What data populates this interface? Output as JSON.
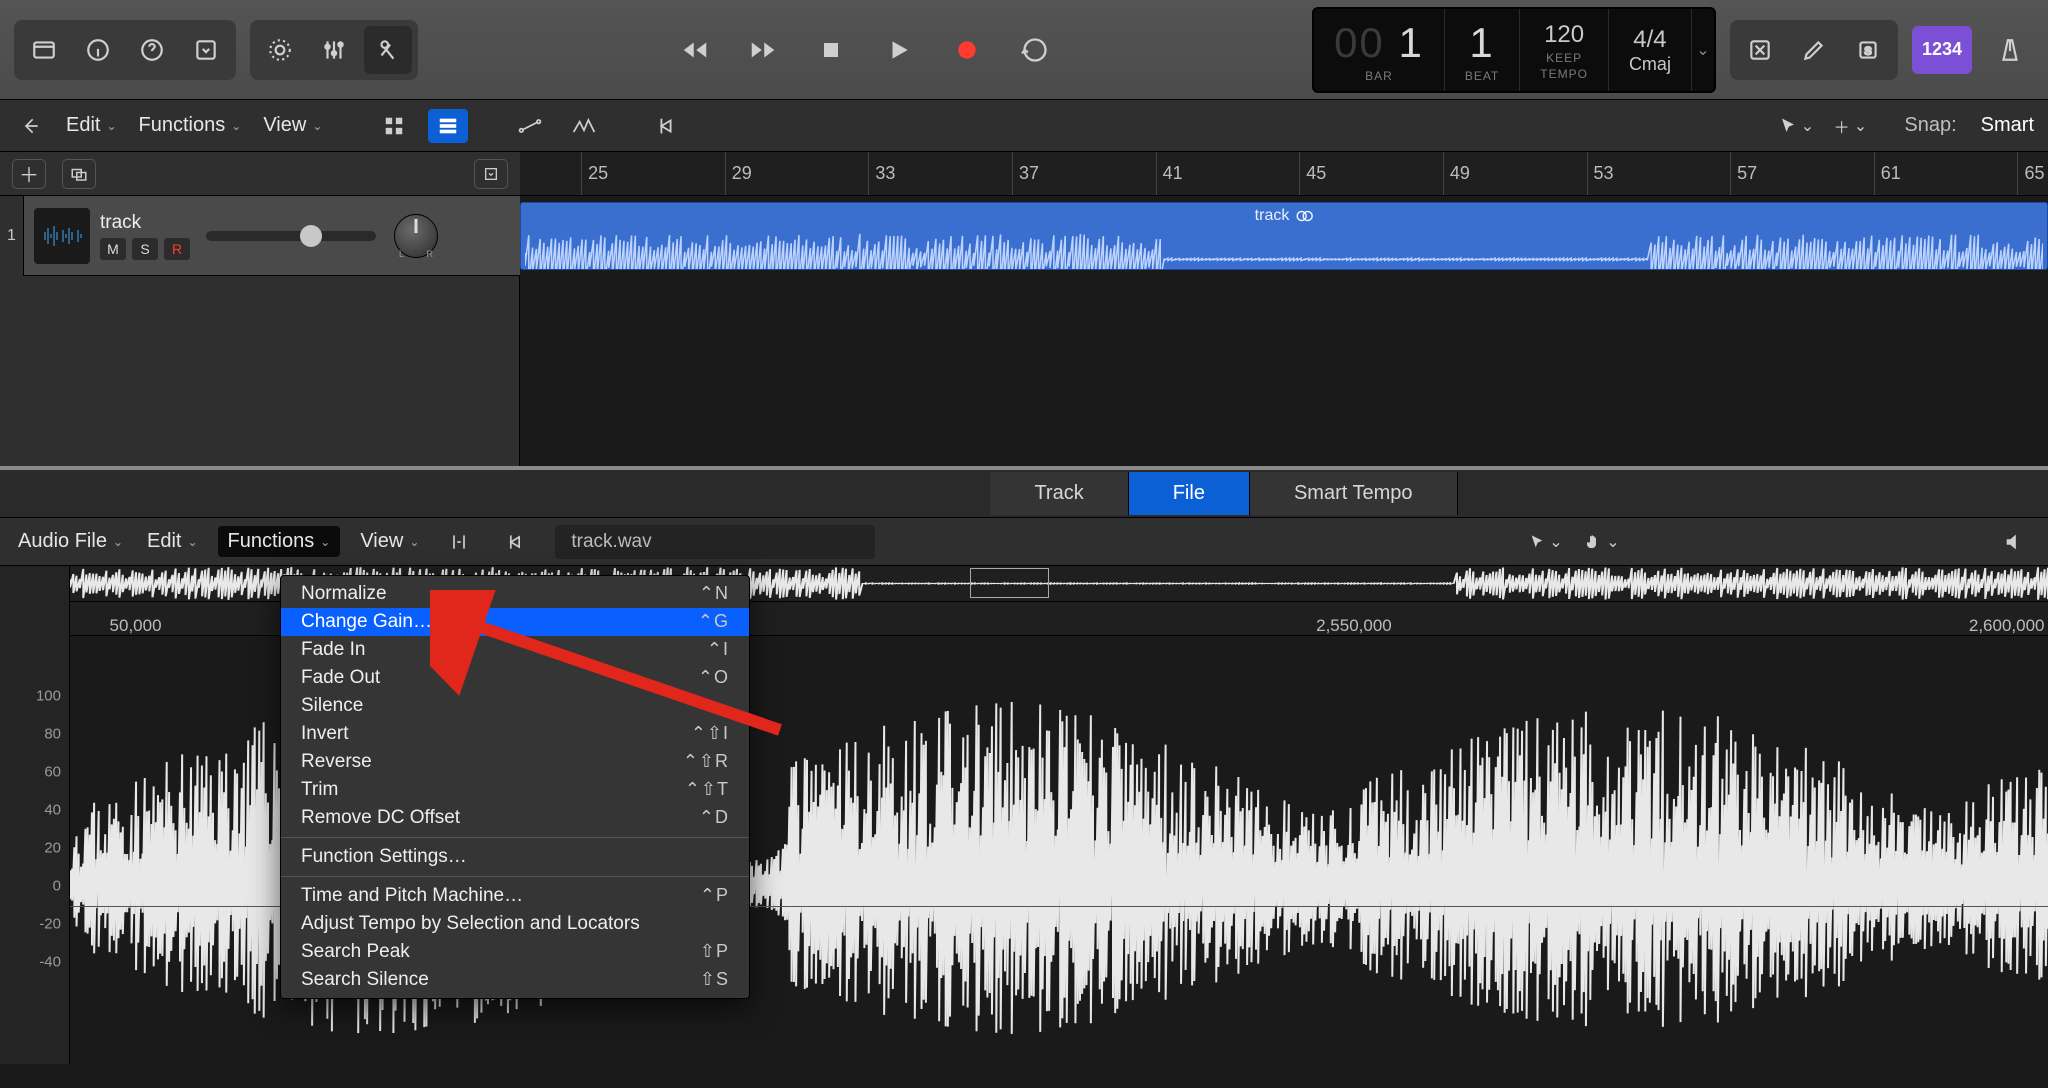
{
  "lcd": {
    "bar_dim": "00",
    "bar": "1",
    "beat": "1",
    "tempo": "120",
    "tempo_sub": "KEEP",
    "sig": "4/4",
    "key": "Cmaj",
    "lbl_bar": "BAR",
    "lbl_beat": "BEAT",
    "lbl_tempo": "TEMPO"
  },
  "badge": "1234",
  "arr": {
    "menus": [
      "Edit",
      "Functions",
      "View"
    ],
    "snap_lbl": "Snap:",
    "snap_val": "Smart",
    "ruler": [
      "25",
      "29",
      "33",
      "37",
      "41",
      "45",
      "49",
      "53",
      "57",
      "61",
      "65"
    ]
  },
  "track": {
    "index": "1",
    "name": "track",
    "m": "M",
    "s": "S",
    "r": "R",
    "pan_l": "L",
    "pan_r": "R",
    "region": "track"
  },
  "ed_tabs": [
    "Track",
    "File",
    "Smart Tempo"
  ],
  "ed_tabs_active": 1,
  "ed_bar": {
    "menus": [
      "Audio File",
      "Edit",
      "Functions",
      "View"
    ],
    "filename": "track.wav"
  },
  "sample_ruler": [
    "50,000",
    "2,550,000",
    "2,600,000"
  ],
  "gutter": [
    "100",
    "80",
    "60",
    "40",
    "20",
    "0",
    "-20",
    "-40"
  ],
  "ctx": {
    "g1": [
      {
        "l": "Normalize",
        "s": "⌃N"
      },
      {
        "l": "Change Gain…",
        "s": "⌃G",
        "hl": true
      },
      {
        "l": "Fade In",
        "s": "⌃I"
      },
      {
        "l": "Fade Out",
        "s": "⌃O"
      },
      {
        "l": "Silence",
        "s": ""
      },
      {
        "l": "Invert",
        "s": "⌃⇧I"
      },
      {
        "l": "Reverse",
        "s": "⌃⇧R"
      },
      {
        "l": "Trim",
        "s": "⌃⇧T"
      },
      {
        "l": "Remove DC Offset",
        "s": "⌃D"
      }
    ],
    "g2": [
      {
        "l": "Function Settings…",
        "s": ""
      }
    ],
    "g3": [
      {
        "l": "Time and Pitch Machine…",
        "s": "⌃P"
      },
      {
        "l": "Adjust Tempo by Selection and Locators",
        "s": ""
      },
      {
        "l": "Search Peak",
        "s": "⇧P"
      },
      {
        "l": "Search Silence",
        "s": "⇧S"
      }
    ]
  }
}
